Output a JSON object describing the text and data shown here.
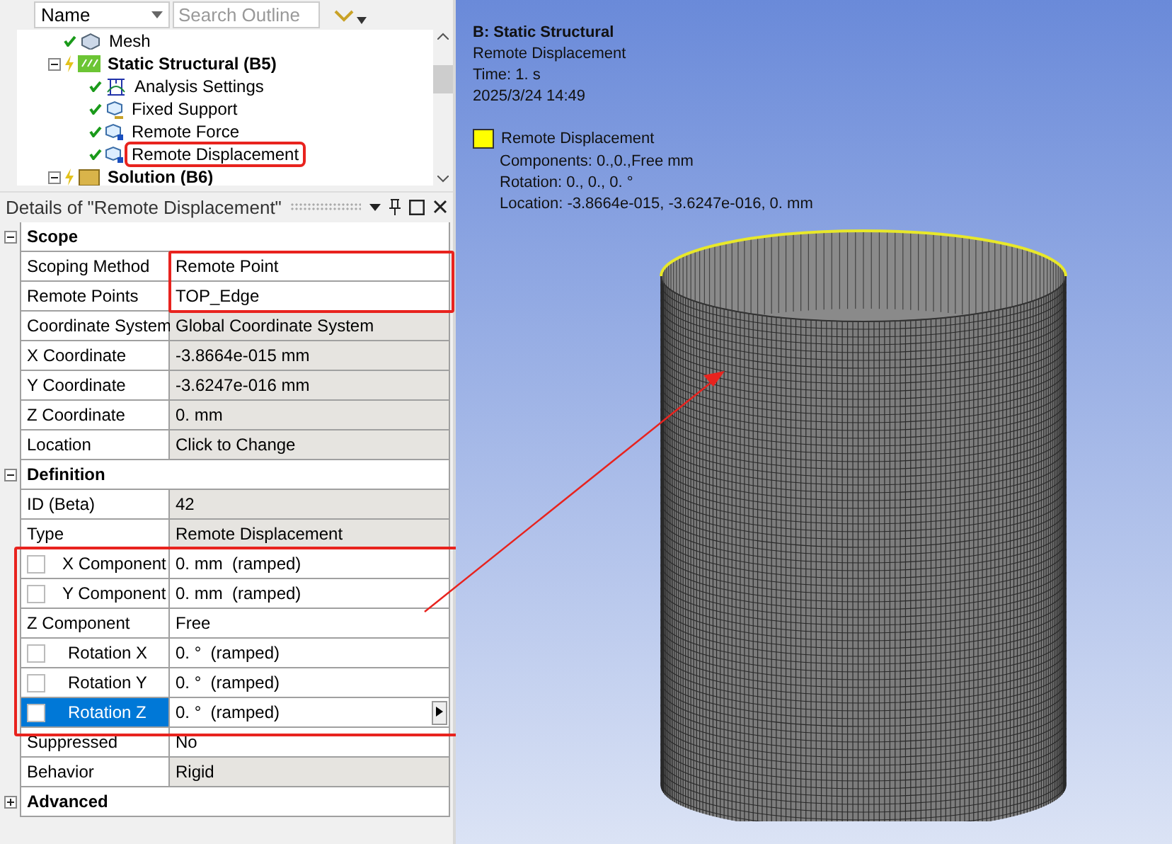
{
  "outline": {
    "name_column": "Name",
    "search": {
      "placeholder": "Search Outline"
    },
    "tree": [
      {
        "label": "Mesh",
        "bold": false,
        "selected": false
      },
      {
        "label": "Static Structural (B5)",
        "bold": true,
        "expanded": true,
        "selected": false,
        "children": [
          {
            "label": "Analysis Settings",
            "bold": false,
            "selected": false
          },
          {
            "label": "Fixed Support",
            "bold": false,
            "selected": false
          },
          {
            "label": "Remote Force",
            "bold": false,
            "selected": false
          },
          {
            "label": "Remote Displacement",
            "bold": false,
            "selected": true
          }
        ]
      },
      {
        "label": "Solution (B6)",
        "bold": true,
        "expanded": true,
        "selected": false
      }
    ]
  },
  "details": {
    "title": "Details of \"Remote Displacement\"",
    "rows": [
      {
        "kind": "section",
        "label": "Scope",
        "expanded": true
      },
      {
        "kind": "property",
        "label": "Scoping Method",
        "value": "Remote Point",
        "readonly": false
      },
      {
        "kind": "property",
        "label": "Remote Points",
        "value": "TOP_Edge",
        "readonly": false
      },
      {
        "kind": "property",
        "label": "Coordinate System",
        "value": "Global Coordinate System",
        "readonly": true
      },
      {
        "kind": "property",
        "label": "X Coordinate",
        "value": "-3.8664e-015 mm",
        "readonly": true
      },
      {
        "kind": "property",
        "label": "Y Coordinate",
        "value": "-3.6247e-016 mm",
        "readonly": true
      },
      {
        "kind": "property",
        "label": "Z Coordinate",
        "value": "0. mm",
        "readonly": true
      },
      {
        "kind": "property",
        "label": "Location",
        "value": "Click to Change",
        "readonly": true
      },
      {
        "kind": "section",
        "label": "Definition",
        "expanded": true
      },
      {
        "kind": "property",
        "label": "ID (Beta)",
        "value": "42",
        "readonly": true
      },
      {
        "kind": "property",
        "label": "Type",
        "value": "Remote Displacement",
        "readonly": true
      },
      {
        "kind": "checkbox",
        "label": "X Component",
        "value": "0. mm  (ramped)",
        "checked": false,
        "selected": false
      },
      {
        "kind": "checkbox",
        "label": "Y Component",
        "value": "0. mm  (ramped)",
        "checked": false,
        "selected": false
      },
      {
        "kind": "property",
        "label": "Z Component",
        "value": "Free",
        "readonly": false
      },
      {
        "kind": "rotation",
        "label": "Rotation X",
        "value": "0. °  (ramped)",
        "checked": false,
        "selected": false
      },
      {
        "kind": "rotation",
        "label": "Rotation Y",
        "value": "0. °  (ramped)",
        "checked": false,
        "selected": false
      },
      {
        "kind": "rotation",
        "label": "Rotation Z",
        "value": "0. °  (ramped)",
        "checked": false,
        "selected": true
      },
      {
        "kind": "property",
        "label": "Suppressed",
        "value": "No",
        "readonly": false
      },
      {
        "kind": "property",
        "label": "Behavior",
        "value": "Rigid",
        "readonly": true
      },
      {
        "kind": "section",
        "label": "Advanced",
        "expanded": false
      }
    ]
  },
  "viewport": {
    "title": "B: Static Structural",
    "subtitle": "Remote Displacement",
    "time": "Time: 1. s",
    "date": "2025/3/24 14:49",
    "legend": {
      "label": "Remote Displacement",
      "color": "#ffff00",
      "lines": [
        "Components: 0.,0.,Free mm",
        "Rotation: 0., 0., 0. °",
        "Location: -3.8664e-015, -3.6247e-016, 0. mm"
      ]
    }
  }
}
